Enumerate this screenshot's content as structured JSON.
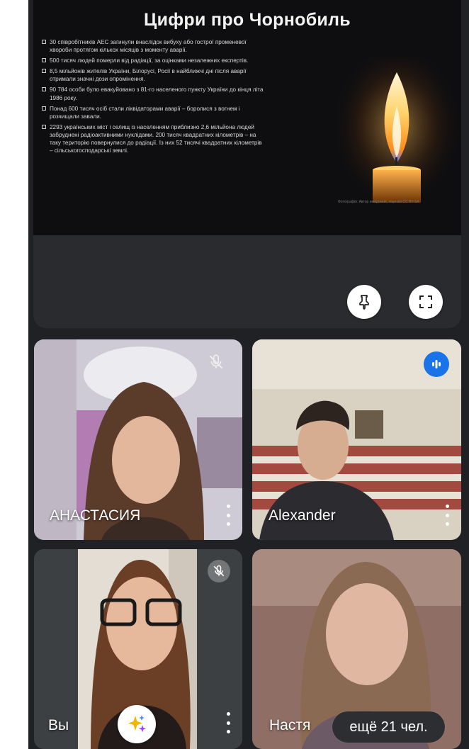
{
  "presentation": {
    "slide_title": "Цифри про Чорнобиль",
    "facts": [
      "30 співробітників АЕС загинули внаслідок вибуху або гострої променевої хвороби протягом кількох місяців з моменту аварії.",
      "500 тисяч людей померли від радіації, за оцінками незалежних експертів.",
      "8,5 мільйонів жителів України, Білорусі, Росії в найближчі дні після аварії отримали значні дози опромінення.",
      "90 784 особи було евакуйовано з 81-го населеного пункту України до кінця літа 1986 року.",
      "Понад 600 тисяч осіб стали ліквідаторами аварії – боролися з вогнем і розчищали завали.",
      "2293 українських міст і селищ із населенням приблизно 2,6 мільйона людей забруднені радіоактивними нуклідами. 200 тисяч квадратних кілометрів – на таку територію повернулися до радіації. Із них 52 тисячі квадратних кілометрів – сільськогосподарські землі."
    ],
    "image_credit": "Фотографія: Автор невідомий, ліцензія CC BY-SA",
    "pin_icon": "pin-icon",
    "fullscreen_icon": "fullscreen-icon"
  },
  "participants": [
    {
      "name": "АНАСТАСИЯ",
      "status": "muted",
      "colors": {
        "wall": "#cfcbd6",
        "accent": "#b27db2"
      }
    },
    {
      "name": "Alexander",
      "status": "speaking",
      "colors": {
        "wall": "#d9d1c2",
        "accent": "#9b3b35"
      }
    },
    {
      "name": "Вы",
      "status": "muted",
      "colors": {
        "wall": "#e3ddd4",
        "accent": "#2b2320"
      }
    },
    {
      "name": "Настя",
      "status": "none",
      "colors": {
        "wall": "#8f6e66",
        "accent": "#6d5a67"
      }
    }
  ],
  "more_participants": "ещё 21 чел.",
  "colors": {
    "app_background": "#202124",
    "tile_background": "#3c4043",
    "speaking_accent": "#1a73e8",
    "page_margin": "#ffffff"
  }
}
